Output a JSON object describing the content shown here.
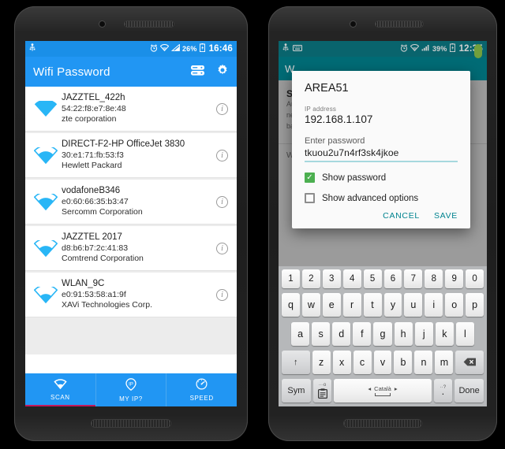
{
  "left_phone": {
    "statusbar": {
      "icons_left": [
        "usb-icon"
      ],
      "alarm": "alarm-icon",
      "wifi": "wifi-icon",
      "signal": "signal-icon",
      "battery_pct": "26%",
      "time": "16:46"
    },
    "appbar": {
      "title": "Wifi Password",
      "actions": [
        "database-icon",
        "gear-icon"
      ]
    },
    "networks": [
      {
        "ssid": "JAZZTEL_422h",
        "mac": "54:22:f8:e7:8e:48",
        "vendor": "zte corporation"
      },
      {
        "ssid": "DIRECT-F2-HP OfficeJet 3830",
        "mac": "30:e1:71:fb:53:f3",
        "vendor": "Hewlett Packard"
      },
      {
        "ssid": "vodafoneB346",
        "mac": "e0:60:66:35:b3:47",
        "vendor": "Sercomm Corporation"
      },
      {
        "ssid": "JAZZTEL 2017",
        "mac": "d8:b6:b7:2c:41:83",
        "vendor": "Comtrend Corporation"
      },
      {
        "ssid": "WLAN_9C",
        "mac": "e0:91:53:58:a1:9f",
        "vendor": "XAVi Technologies Corp."
      }
    ],
    "bottom_nav": [
      {
        "label": "SCAN",
        "icon": "wifi-icon",
        "active": true
      },
      {
        "label": "MY IP?",
        "icon": "ip-pin-icon",
        "active": false
      },
      {
        "label": "SPEED",
        "icon": "speedometer-icon",
        "active": false
      }
    ]
  },
  "right_phone": {
    "statusbar": {
      "battery_pct": "39%",
      "time": "12:35"
    },
    "background": {
      "appbar_title": "W",
      "heading": "S",
      "lines": [
        "Au",
        "ne",
        "ba"
      ],
      "row_label": "W"
    },
    "dialog": {
      "title": "AREA51",
      "ip_label": "IP address",
      "ip_value": "192.168.1.107",
      "password_label": "Enter password",
      "password_value": "tkuou2u7n4rf3sk4jkoe",
      "show_password_label": "Show password",
      "show_password_checked": true,
      "advanced_label": "Show advanced options",
      "advanced_checked": false,
      "cancel_label": "CANCEL",
      "save_label": "SAVE"
    },
    "keyboard": {
      "row_numbers": [
        "1",
        "2",
        "3",
        "4",
        "5",
        "6",
        "7",
        "8",
        "9",
        "0"
      ],
      "row_1": [
        "q",
        "w",
        "e",
        "r",
        "t",
        "y",
        "u",
        "i",
        "o",
        "p"
      ],
      "row_2": [
        "a",
        "s",
        "d",
        "f",
        "g",
        "h",
        "j",
        "k",
        "l"
      ],
      "row_3": [
        "z",
        "x",
        "c",
        "v",
        "b",
        "n",
        "m"
      ],
      "shift_label": "↑",
      "backspace_label": "⌫",
      "sym_label": "Sym",
      "clip_label": "Ὄb",
      "clip_sub": "···o",
      "space_language": "Català",
      "space_arrow_left": "◂",
      "space_arrow_right": "▸",
      "punct_sub": "··?",
      "punct_label": "·",
      "done_label": "Done"
    }
  },
  "colors": {
    "blue_primary": "#2196F3",
    "blue_status": "#1a8fe8",
    "teal_primary": "#00838f",
    "teal_status": "#0b7a85",
    "accent_pink": "#c2185b",
    "green_check": "#4CAF50"
  }
}
